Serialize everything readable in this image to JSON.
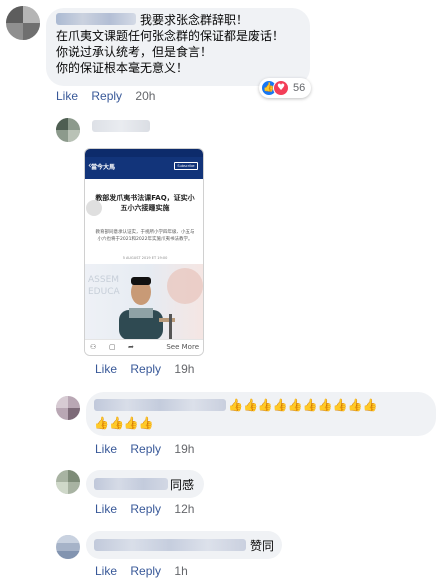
{
  "comment1": {
    "lines": [
      "我要求张念群辞职！",
      "在爪夷文课题任何张念群的保证都是废话！",
      "你说过承认统考，但是食言！",
      "你的保证根本毫无意义！"
    ],
    "like": "Like",
    "reply": "Reply",
    "time": "20h",
    "reaction_count": "56"
  },
  "comment2": {
    "like": "Like",
    "reply": "Reply",
    "time": "19h",
    "screenshot": {
      "logo": "當今大馬",
      "subscribe": "Subscribe",
      "title": "教部发爪夷书法课FAQ，证实小五小六接踵实施",
      "lead": "教育部同意承认证实，于视所小学四年级、小五与小六也将于2021和2022年实施爪夷书法教学。",
      "date": "5 AUGUST 2019 ET 19:00",
      "see_more": "See More"
    }
  },
  "comment3": {
    "emojis_line1": "👍👍👍👍👍👍👍👍👍👍",
    "emojis_line2": "👍👍👍👍",
    "like": "Like",
    "reply": "Reply",
    "time": "19h"
  },
  "comment4": {
    "text": "同感",
    "like": "Like",
    "reply": "Reply",
    "time": "12h"
  },
  "comment5": {
    "text": "赞同",
    "like": "Like",
    "reply": "Reply",
    "time": "1h"
  },
  "colors": {
    "bubble": "#f0f2f5",
    "link": "#385898",
    "like_blue": "#1877f2",
    "love_red": "#f33e58"
  }
}
